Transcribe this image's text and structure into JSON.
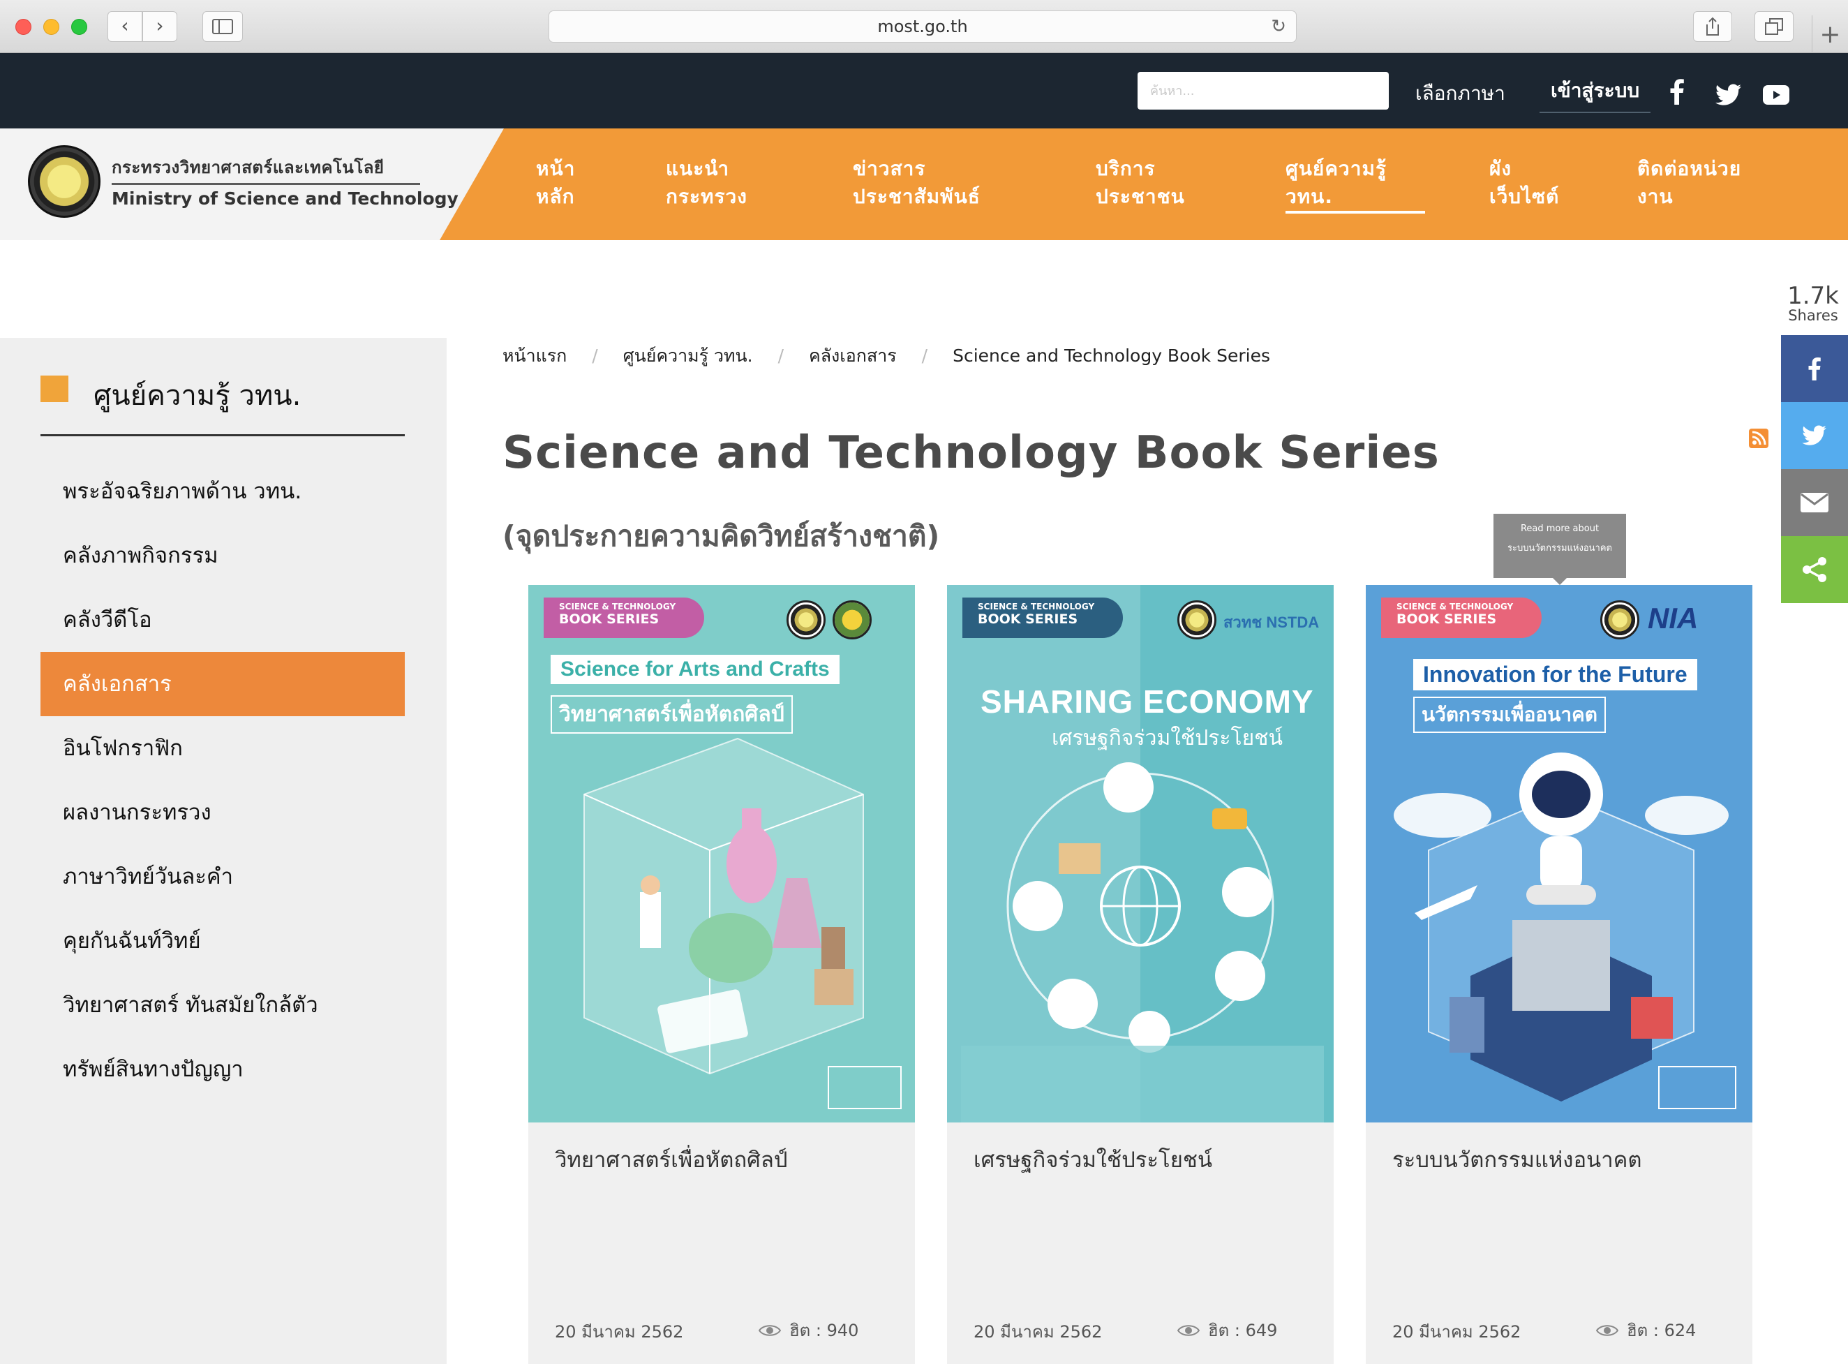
{
  "browser": {
    "url": "most.go.th",
    "back_glyph": "‹",
    "forward_glyph": "›",
    "reload_glyph": "↻",
    "newtab_glyph": "+"
  },
  "topbar": {
    "search_placeholder": "ค้นหา...",
    "language_label": "เลือกภาษา",
    "login_label": "เข้าสู่ระบบ",
    "social_icons": [
      "facebook-icon",
      "twitter-icon",
      "youtube-icon"
    ]
  },
  "header": {
    "logo_th": "กระทรวงวิทยาศาสตร์และเทคโนโลยี",
    "logo_en": "Ministry of Science and Technology",
    "nav": [
      {
        "line1": "หน้า",
        "line2": "หลัก"
      },
      {
        "line1": "แนะนำ",
        "line2": "กระทรวง"
      },
      {
        "line1": "ข่าวสาร",
        "line2": "ประชาสัมพันธ์"
      },
      {
        "line1": "บริการ",
        "line2": "ประชาชน"
      },
      {
        "line1": "ศูนย์ความรู้",
        "line2": "วทน."
      },
      {
        "line1": "ผัง",
        "line2": "เว็บไซต์"
      },
      {
        "line1": "ติดต่อหน่วย",
        "line2": "งาน"
      }
    ],
    "active_nav_index": 4
  },
  "sidebar": {
    "title": "ศูนย์ความรู้ วทน.",
    "items": [
      {
        "label": "พระอัจฉริยภาพด้าน วทน."
      },
      {
        "label": "คลังภาพกิจกรรม"
      },
      {
        "label": "คลังวีดีโอ"
      },
      {
        "label": "คลังเอกสาร"
      },
      {
        "label": "อินโฟกราฟิก"
      },
      {
        "label": "ผลงานกระทรวง"
      },
      {
        "label": "ภาษาวิทย์วันละคำ"
      },
      {
        "label": "คุยกันฉันท์วิทย์"
      },
      {
        "label": "วิทยาศาสตร์ ทันสมัยใกล้ตัว"
      },
      {
        "label": "ทรัพย์สินทางปัญญา"
      }
    ],
    "active_index": 3,
    "accent_color": "#ed883b"
  },
  "share": {
    "count": "1.7k",
    "count_label": "Shares",
    "buttons": [
      {
        "name": "facebook-share",
        "color": "#3b5998"
      },
      {
        "name": "twitter-share",
        "color": "#55acee"
      },
      {
        "name": "email-share",
        "color": "#7d7d7d"
      },
      {
        "name": "share-share",
        "color": "#7bc043"
      }
    ]
  },
  "breadcrumb": [
    "หน้าแรก",
    "ศูนย์ความรู้ วทน.",
    "คลังเอกสาร",
    "Science and Technology Book Series"
  ],
  "page": {
    "title": "Science and Technology Book Series",
    "subtitle": "(จุดประกายความคิดวิทย์สร้างชาติ)"
  },
  "tooltip": {
    "line1": "Read more about",
    "line2": "ระบบนวัตกรรมแห่งอนาคต"
  },
  "cards": [
    {
      "title": "วิทยาศาสตร์เพื่อหัตถศิลป์",
      "date": "20 มีนาคม 2562",
      "hits": "ฮิต : 940",
      "cover_en": "Science for Arts and Crafts",
      "cover_th": "วิทยาศาสตร์เพื่อหัตถศิลป์",
      "series_small": "SCIENCE & TECHNOLOGY",
      "series_big": "BOOK SERIES",
      "bg": "#7fcdc9",
      "badge": "#c25ea5"
    },
    {
      "title": "เศรษฐกิจร่วมใช้ประโยชน์",
      "date": "20 มีนาคม 2562",
      "hits": "ฮิต : 649",
      "cover_en": "SHARING ECONOMY",
      "cover_th": "เศรษฐกิจร่วมใช้ประโยชน์",
      "series_small": "SCIENCE & TECHNOLOGY",
      "series_big": "BOOK SERIES",
      "logo_text": "สวทช NSTDA",
      "bg": "#66bfc6",
      "badge": "#2b5f80"
    },
    {
      "title": "ระบบนวัตกรรมแห่งอนาคต",
      "date": "20 มีนาคม 2562",
      "hits": "ฮิต : 624",
      "cover_en": "Innovation for the Future",
      "cover_th": "นวัตกรรมเพื่ออนาคต",
      "series_small": "SCIENCE & TECHNOLOGY",
      "series_big": "BOOK SERIES",
      "logo_text": "NIA",
      "bg": "#5aa0d8",
      "badge": "#e8657a"
    }
  ]
}
